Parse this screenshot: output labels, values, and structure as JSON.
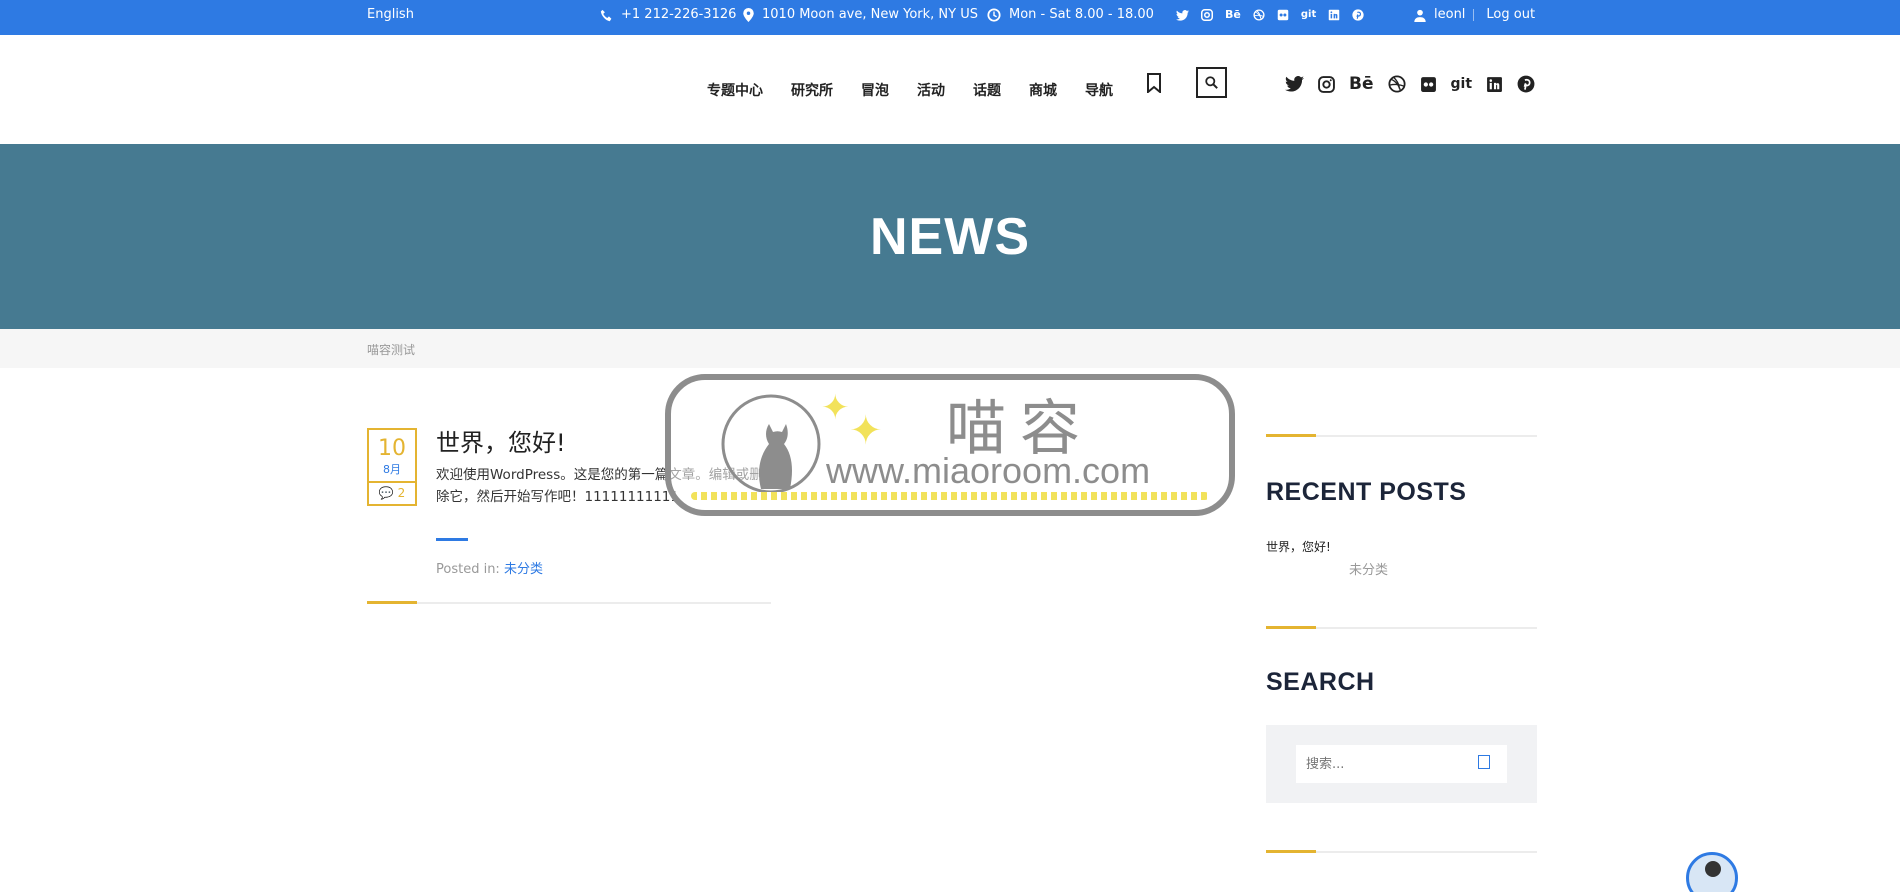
{
  "topbar": {
    "language": "English",
    "phone": "+1 212-226-3126",
    "address": "1010 Moon ave, New York, NY US",
    "hours": "Mon - Sat 8.00 - 18.00",
    "social_icons": [
      "twitter-icon",
      "instagram-icon",
      "behance-icon",
      "dribbble-icon",
      "flickr-icon",
      "git-icon",
      "linkedin-icon",
      "pinterest-icon"
    ],
    "username": "leonl",
    "logout": "Log out"
  },
  "nav": {
    "items": [
      "专题中心",
      "研究所",
      "冒泡",
      "活动",
      "话题",
      "商城",
      "导航"
    ]
  },
  "header_social": {
    "behance": "Bē",
    "git": "git"
  },
  "banner": {
    "title": "NEWS"
  },
  "breadcrumb": {
    "text": "喵容测试"
  },
  "post": {
    "day": "10",
    "month": "8月",
    "comments": "2",
    "title": "世界，您好!",
    "excerpt": "欢迎使用WordPress。这是您的第一篇文章。编辑或删除它，然后开始写作吧！11111111111",
    "posted_in_label": "Posted in:",
    "category": "未分类"
  },
  "sidebar": {
    "recent_title": "RECENT POSTS",
    "recent_post": "世界，您好!",
    "recent_category": "未分类",
    "search_title": "SEARCH",
    "search_placeholder": "搜索..."
  },
  "watermark": {
    "brand": "喵容",
    "url": "www.miaoroom.com"
  },
  "colors": {
    "topbar": "#2e7ae3",
    "banner": "#467a91",
    "accent_gold": "#e4b431",
    "link_blue": "#2e7ae3"
  }
}
